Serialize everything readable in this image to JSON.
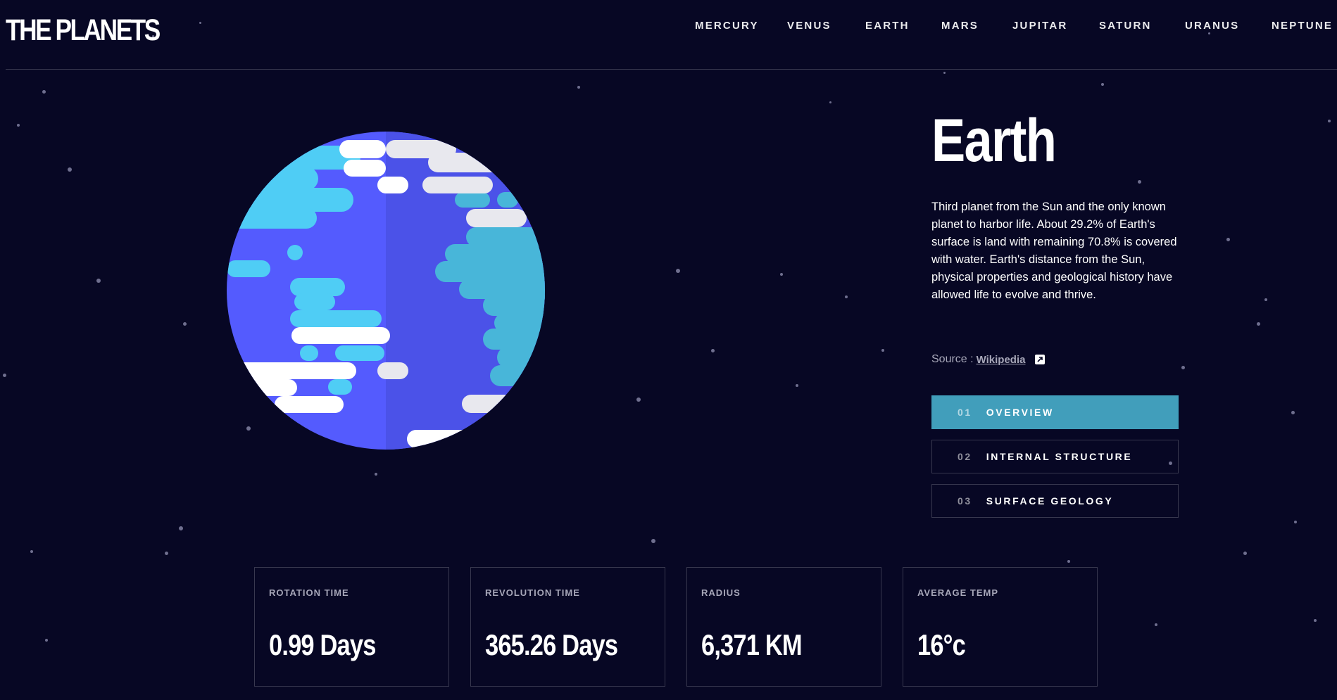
{
  "brand": {
    "logo_text": "THE PLANETS"
  },
  "nav": {
    "items": [
      {
        "label": "MERCURY"
      },
      {
        "label": "VENUS"
      },
      {
        "label": "EARTH"
      },
      {
        "label": "MARS"
      },
      {
        "label": "JUPITAR"
      },
      {
        "label": "SATURN"
      },
      {
        "label": "URANUS"
      },
      {
        "label": "NEPTUNE"
      }
    ]
  },
  "planet": {
    "name": "Earth",
    "description": "Third planet from the Sun and the only known planet to harbor life. About 29.2% of Earth's surface is land with remaining 70.8% is covered with water. Earth's distance from the Sun, physical properties and geological history have allowed life to evolve and thrive.",
    "source_prefix": "Source : ",
    "source_link_label": "Wikipedia",
    "image_icon": "earth-planet-illustration"
  },
  "tabs": [
    {
      "num": "01",
      "label": "OVERVIEW",
      "active": true
    },
    {
      "num": "02",
      "label": "INTERNAL STRUCTURE",
      "active": false
    },
    {
      "num": "03",
      "label": "SURFACE GEOLOGY",
      "active": false
    }
  ],
  "stats": [
    {
      "label": "ROTATION TIME",
      "value": "0.99 Days"
    },
    {
      "label": "REVOLUTION TIME",
      "value": "365.26 Days"
    },
    {
      "label": "RADIUS",
      "value": "6,371 KM"
    },
    {
      "label": "AVERAGE TEMP",
      "value": "16°c"
    }
  ],
  "colors": {
    "background": "#070724",
    "divider": "#38384f",
    "active_tab": "#419ebb",
    "muted_text": "#a7a7b9",
    "planet_ocean": "#545bfe",
    "planet_ocean_shade": "#4b52e8",
    "planet_land": "#4fcdf5",
    "planet_land_shade": "#48b6d9",
    "planet_cloud": "#ffffff",
    "planet_cloud_shade": "#e8e8ee"
  },
  "icons": {
    "external_link": "external-link-icon"
  }
}
